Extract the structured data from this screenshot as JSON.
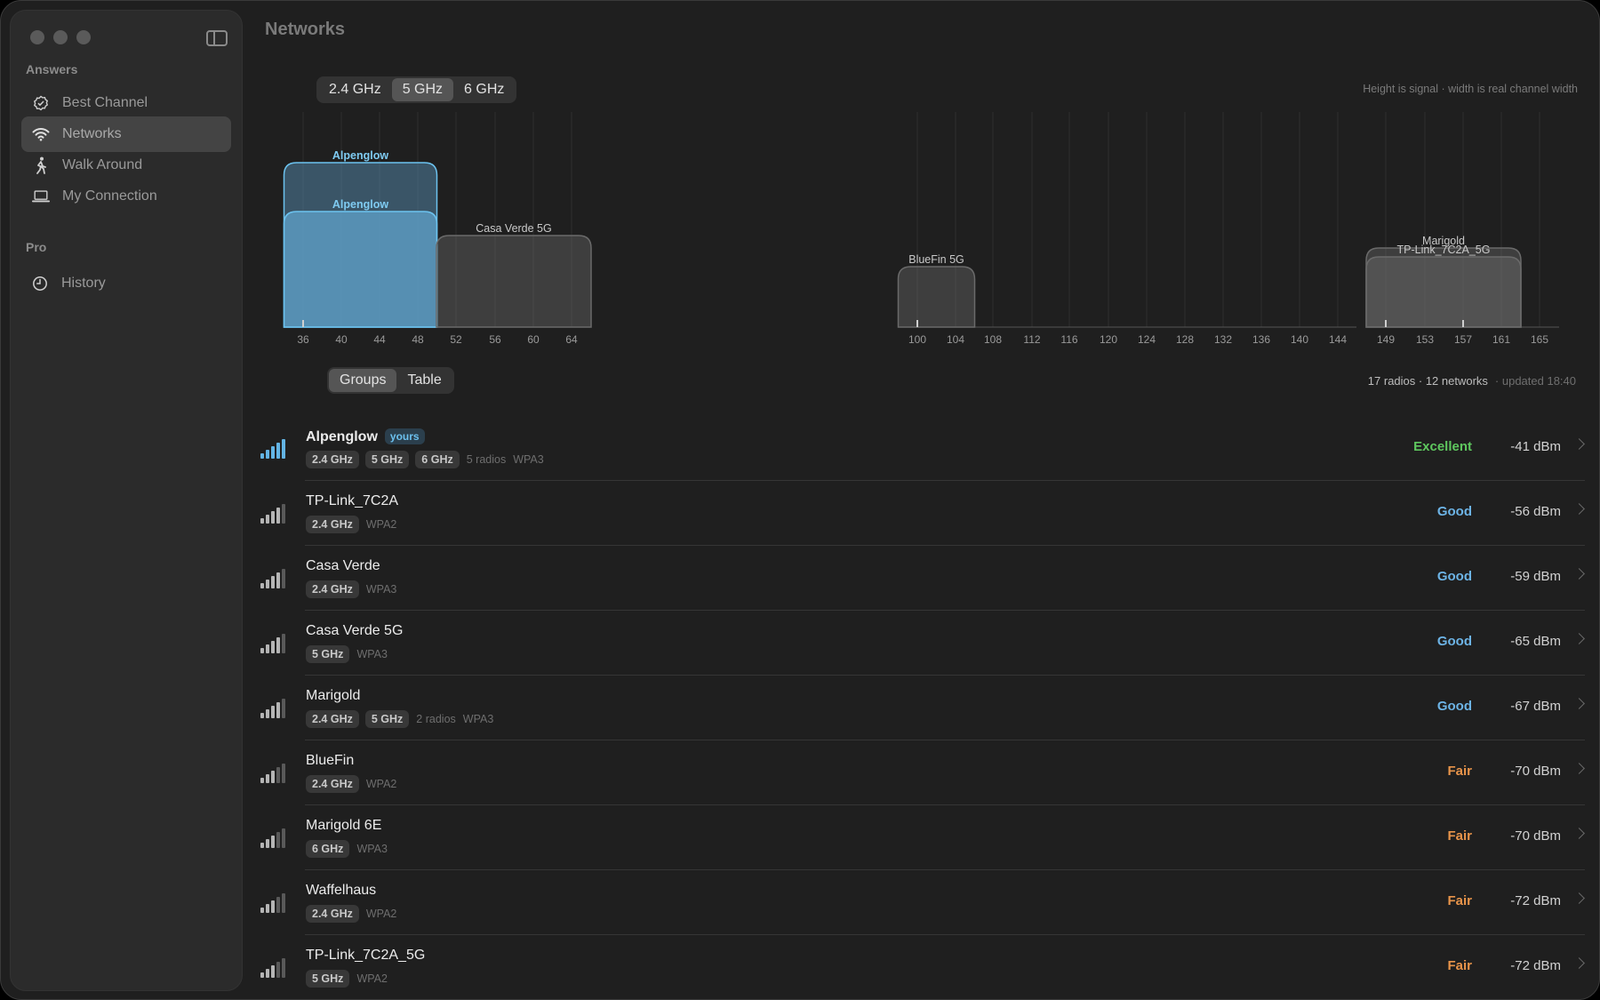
{
  "window": {
    "title": "Networks"
  },
  "sidebar": {
    "sections": [
      {
        "label": "Answers",
        "items": [
          {
            "label": "Best Channel",
            "icon": "check-badge-icon",
            "active": false
          },
          {
            "label": "Networks",
            "icon": "wifi-icon",
            "active": true
          },
          {
            "label": "Walk Around",
            "icon": "walking-icon",
            "active": false
          },
          {
            "label": "My Connection",
            "icon": "laptop-icon",
            "active": false
          }
        ]
      },
      {
        "label": "Pro",
        "items": [
          {
            "label": "History",
            "icon": "clock-icon",
            "active": false
          }
        ]
      }
    ]
  },
  "band_tabs": [
    "2.4 GHz",
    "5 GHz",
    "6 GHz"
  ],
  "band_selected": "5 GHz",
  "chart_hint": "Height is signal · width is real channel width",
  "view_tabs": [
    "Groups",
    "Table"
  ],
  "view_selected": "Groups",
  "summary": {
    "counts": "17 radios · 12 networks",
    "updated": "· updated 18:40"
  },
  "chart_data": {
    "type": "area",
    "x_ticks": [
      "36",
      "40",
      "44",
      "48",
      "52",
      "56",
      "60",
      "64",
      "100",
      "104",
      "108",
      "112",
      "116",
      "120",
      "124",
      "128",
      "132",
      "136",
      "140",
      "144",
      "149",
      "153",
      "157",
      "161",
      "165"
    ],
    "channels": [
      {
        "name": "Alpenglow",
        "from": 36,
        "to": 48,
        "signal": -41,
        "highlight": true
      },
      {
        "name": "Alpenglow",
        "from": 36,
        "to": 48,
        "signal": -50,
        "highlight": true
      },
      {
        "name": "Casa Verde 5G",
        "from": 52,
        "to": 64,
        "signal": -65,
        "highlight": false
      },
      {
        "name": "BlueFin 5G",
        "from": 100,
        "to": 104,
        "signal": -70,
        "highlight": false
      },
      {
        "name": "Marigold",
        "from": 149,
        "to": 161,
        "signal": -67,
        "highlight": false
      },
      {
        "name": "TP-Link_7C2A_5G",
        "from": 149,
        "to": 161,
        "signal": -72,
        "highlight": false
      }
    ]
  },
  "networks": [
    {
      "name": "Alpenglow",
      "bold": true,
      "yours": "yours",
      "tags": [
        "2.4 GHz",
        "5 GHz",
        "6 GHz"
      ],
      "extra": [
        "5 radios",
        "WPA3"
      ],
      "quality": "Excellent",
      "qclass": "q-excellent",
      "dbm": "-41 dBm",
      "bars": 5
    },
    {
      "name": "TP-Link_7C2A",
      "tags": [
        "2.4 GHz"
      ],
      "extra": [
        "WPA2"
      ],
      "quality": "Good",
      "qclass": "q-good",
      "dbm": "-56 dBm",
      "bars": 4
    },
    {
      "name": "Casa Verde",
      "tags": [
        "2.4 GHz"
      ],
      "extra": [
        "WPA3"
      ],
      "quality": "Good",
      "qclass": "q-good",
      "dbm": "-59 dBm",
      "bars": 4
    },
    {
      "name": "Casa Verde 5G",
      "tags": [
        "5 GHz"
      ],
      "extra": [
        "WPA3"
      ],
      "quality": "Good",
      "qclass": "q-good",
      "dbm": "-65 dBm",
      "bars": 4
    },
    {
      "name": "Marigold",
      "tags": [
        "2.4 GHz",
        "5 GHz"
      ],
      "extra": [
        "2 radios",
        "WPA3"
      ],
      "quality": "Good",
      "qclass": "q-good",
      "dbm": "-67 dBm",
      "bars": 4
    },
    {
      "name": "BlueFin",
      "tags": [
        "2.4 GHz"
      ],
      "extra": [
        "WPA2"
      ],
      "quality": "Fair",
      "qclass": "q-fair",
      "dbm": "-70 dBm",
      "bars": 3
    },
    {
      "name": "Marigold 6E",
      "tags": [
        "6 GHz"
      ],
      "extra": [
        "WPA3"
      ],
      "quality": "Fair",
      "qclass": "q-fair",
      "dbm": "-70 dBm",
      "bars": 3
    },
    {
      "name": "Waffelhaus",
      "tags": [
        "2.4 GHz"
      ],
      "extra": [
        "WPA2"
      ],
      "quality": "Fair",
      "qclass": "q-fair",
      "dbm": "-72 dBm",
      "bars": 3
    },
    {
      "name": "TP-Link_7C2A_5G",
      "tags": [
        "5 GHz"
      ],
      "extra": [
        "WPA2"
      ],
      "quality": "Fair",
      "qclass": "q-fair",
      "dbm": "-72 dBm",
      "bars": 3
    }
  ]
}
